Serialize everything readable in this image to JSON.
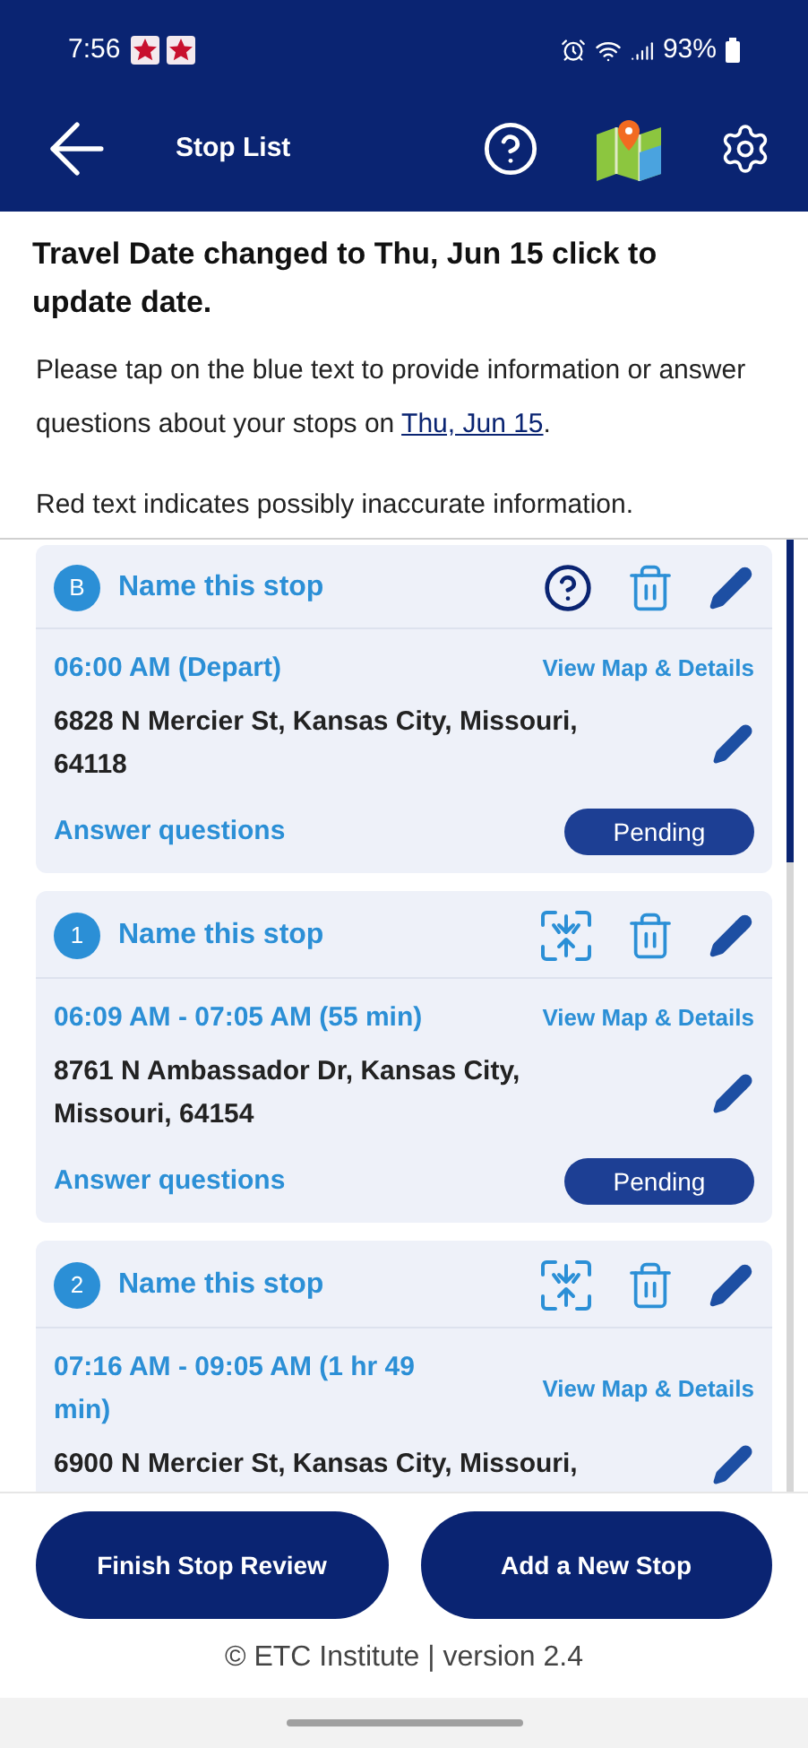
{
  "status_bar": {
    "time": "7:56",
    "battery": "93%"
  },
  "header": {
    "title": "Stop List"
  },
  "banner": "Travel Date changed to Thu, Jun 15 click to update date.",
  "instructions": {
    "text": "Please tap on the blue text to provide information or answer questions about your stops on",
    "date_link": "Thu, Jun 15",
    "end": "."
  },
  "warning": "Red text indicates possibly inaccurate information.",
  "stops": [
    {
      "marker": "B",
      "name": "Name this stop",
      "kind": "help",
      "time": "06:00 AM (Depart)",
      "map_link": "View Map & Details",
      "address": "6828 N Mercier St, Kansas City, Missouri, 64118",
      "questions": "Answer questions",
      "status": "Pending"
    },
    {
      "marker": "1",
      "name": "Name this stop",
      "kind": "merge",
      "time": "06:09 AM - 07:05 AM (55 min)",
      "map_link": "View Map & Details",
      "address": "8761 N Ambassador Dr, Kansas City, Missouri, 64154",
      "questions": "Answer questions",
      "status": "Pending"
    },
    {
      "marker": "2",
      "name": "Name this stop",
      "kind": "merge",
      "time": "07:16 AM - 09:05 AM (1 hr 49 min)",
      "map_link": "View Map & Details",
      "address": "6900 N Mercier St, Kansas City, Missouri,"
    }
  ],
  "buttons": [
    "Finish Stop Review",
    "Add a New Stop"
  ],
  "footer": "© ETC Institute | version 2.4"
}
